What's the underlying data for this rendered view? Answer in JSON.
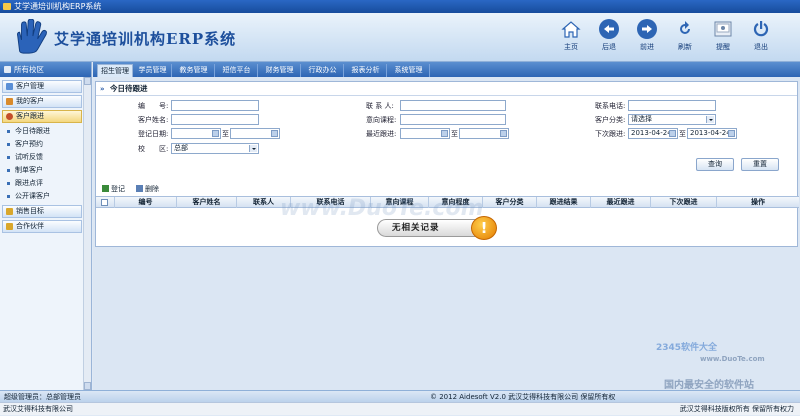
{
  "window": {
    "title": "艾学通培训机构ERP系统"
  },
  "header": {
    "app_title": "艾学通培训机构ERP系统",
    "tools": [
      {
        "label": "主页",
        "icon": "home-icon"
      },
      {
        "label": "后退",
        "icon": "back-icon"
      },
      {
        "label": "前进",
        "icon": "forward-icon"
      },
      {
        "label": "刷新",
        "icon": "refresh-icon"
      },
      {
        "label": "提醒",
        "icon": "reminder-icon"
      },
      {
        "label": "退出",
        "icon": "power-icon"
      }
    ]
  },
  "left_panel": {
    "title": "所有校区",
    "groups": [
      {
        "label": "客户管理"
      },
      {
        "label": "我的客户"
      },
      {
        "label": "客户跟进"
      }
    ],
    "sub_items": [
      "今日待跟进",
      "客户预约",
      "试听反馈",
      "制单客户",
      "跟进点评",
      "公开课客户"
    ],
    "bottom_groups": [
      {
        "label": "销售目标"
      },
      {
        "label": "合作伙伴"
      }
    ]
  },
  "nav_tabs": [
    "招生管理",
    "学员管理",
    "教务管理",
    "短信平台",
    "财务管理",
    "行政办公",
    "报表分析",
    "系统管理"
  ],
  "panel": {
    "title": "今日待跟进",
    "form": {
      "number_label": "编　　号:",
      "contact_label": "联 系 人:",
      "phone_label": "联系电话:",
      "customer_name_label": "客户姓名:",
      "intended_course_label": "意向课程:",
      "customer_category_label": "客户分类:",
      "customer_category_value": "请选择",
      "register_date_label": "登记日期:",
      "recent_followup_label": "最近跟进:",
      "next_followup_label": "下次跟进:",
      "to_label": "至",
      "next_from": "2013-04-24",
      "next_to": "2013-04-24",
      "campus_label": "校　　区:",
      "campus_value": "总部"
    },
    "search_button": "查询",
    "reset_button": "重置"
  },
  "grid": {
    "toolbar": {
      "register_label": "登记",
      "delete_label": "删除"
    },
    "columns": [
      "编号",
      "客户姓名",
      "联系人",
      "联系电话",
      "意向课程",
      "意向程度",
      "客户分类",
      "跟进结果",
      "最近跟进",
      "下次跟进",
      "操作"
    ],
    "empty_message": "无相关记录"
  },
  "statusbar": {
    "admin_text": "超级管理员：总部管理员",
    "copyright_text": "© 2012 Aidesoft V2.0 武汉艾得科技有限公司 保留所有权"
  },
  "bottombar": {
    "left_text": "武汉艾得科技有限公司",
    "right_text": "武汉艾得科技版权所有 保留所有权力"
  },
  "watermarks": {
    "site": "www.DuoTe.com",
    "brand": "2345软件大全",
    "brand_url": "www.DuoTe.com",
    "slogan": "国内最安全的软件站"
  },
  "colors": {
    "accent": "#2d65b4",
    "header_text": "#1d4f9c",
    "warning": "#e37b00"
  }
}
